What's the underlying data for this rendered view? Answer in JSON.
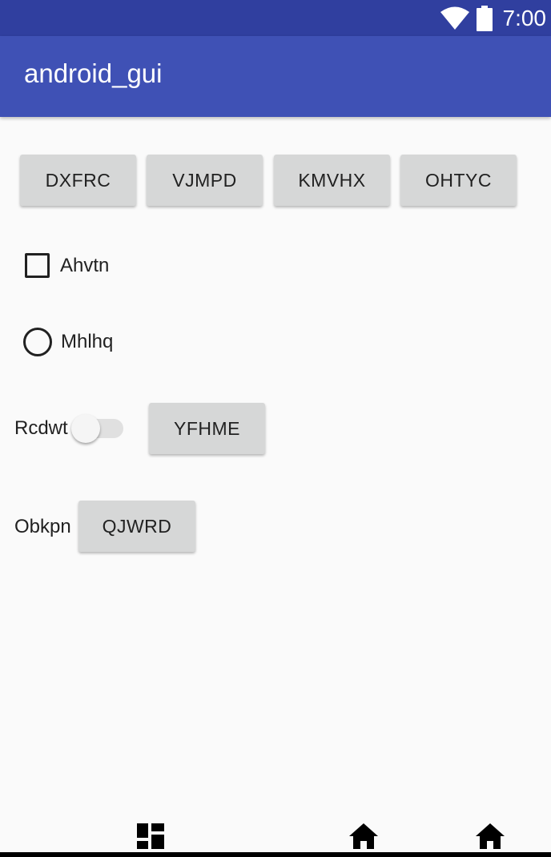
{
  "status_bar": {
    "time": "7:00",
    "icons": [
      "wifi-icon",
      "battery-icon"
    ],
    "color": "#303f9f"
  },
  "app_bar": {
    "title": "android_gui",
    "color": "#3f51b5"
  },
  "buttons_row": [
    {
      "label": "DXFRC"
    },
    {
      "label": "VJMPD"
    },
    {
      "label": "KMVHX"
    },
    {
      "label": "OHTYC"
    }
  ],
  "checkbox": {
    "label": "Ahvtn",
    "checked": false
  },
  "radio": {
    "label": "Mhlhq",
    "selected": false
  },
  "switch_row": {
    "label": "Rcdwt",
    "on": false,
    "button_label": "YFHME"
  },
  "obkpn_row": {
    "label": "Obkpn",
    "button_label": "QJWRD"
  },
  "nav_bar": {
    "icons": [
      "dashboard-icon",
      "home-icon",
      "home-icon"
    ]
  }
}
